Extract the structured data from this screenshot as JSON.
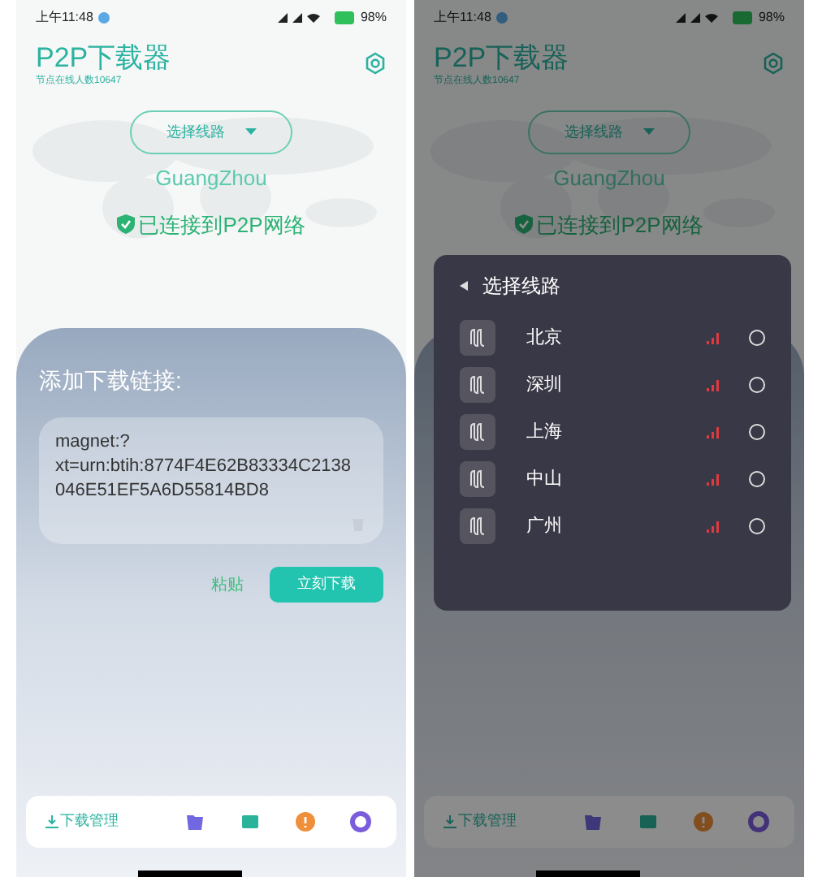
{
  "screens": [
    {
      "status_bar": {
        "time": "上午11:48",
        "battery": "98%"
      },
      "app_title": "P2P下载器",
      "online_count": "节点在线人数10647",
      "route_button": "选择线路",
      "location": "GuangZhou",
      "connection_status": "已连接到P2P网络",
      "download_panel": {
        "title": "添加下载链接:",
        "link_lines": [
          "magnet:?",
          "xt=urn:btih:8774F4E62B83334C2138",
          "046E51EF5A6D55814BD8"
        ],
        "paste_button": "粘贴",
        "download_button": "立刻下载"
      },
      "bottom_bar": {
        "label": "下载管理"
      }
    },
    {
      "status_bar": {
        "time": "上午11:48",
        "battery": "98%"
      },
      "app_title": "P2P下载器",
      "online_count": "节点在线人数10647",
      "route_button": "选择线路",
      "location": "GuangZhou",
      "connection_status": "已连接到P2P网络",
      "route_dialog": {
        "title": "选择线路",
        "routes": [
          {
            "name": "北京",
            "selected": false
          },
          {
            "name": "深圳",
            "selected": false
          },
          {
            "name": "上海",
            "selected": false
          },
          {
            "name": "中山",
            "selected": false
          },
          {
            "name": "广州",
            "selected": false
          }
        ]
      },
      "bottom_bar": {
        "label": "下载管理"
      }
    }
  ]
}
